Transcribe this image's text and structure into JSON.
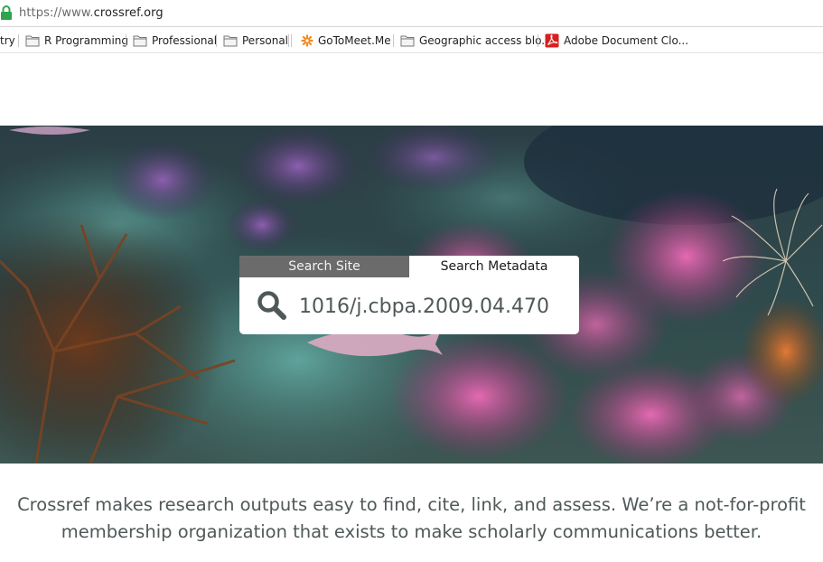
{
  "browser": {
    "url_scheme": "https://www.",
    "url_host": "crossref.org",
    "bookmarks": [
      {
        "label": "try",
        "icon": "none"
      },
      {
        "label": "R Programming",
        "icon": "folder-icon"
      },
      {
        "label": "Professional",
        "icon": "folder-icon"
      },
      {
        "label": "Personal",
        "icon": "folder-icon"
      },
      {
        "label": "GoToMeet.Me",
        "icon": "gotomeeting-icon"
      },
      {
        "label": "Geographic access blo...",
        "icon": "folder-icon"
      },
      {
        "label": "Adobe Document Clo...",
        "icon": "adobe-pdf-icon"
      }
    ]
  },
  "search": {
    "tab_site_label": "Search Site",
    "tab_metadata_label": "Search Metadata",
    "query_value": "1016/j.cbpa.2009.04.470",
    "active_tab": "Search Metadata"
  },
  "tagline": {
    "line1": "Crossref makes research outputs easy to find, cite, link, and assess. We’re a not-for-profit",
    "line2": "membership organization that exists to make scholarly communications better."
  },
  "colors": {
    "text_gray": "#4f5858",
    "tab_inactive": "#6b6b6b",
    "lock_green": "#2ea44f"
  }
}
